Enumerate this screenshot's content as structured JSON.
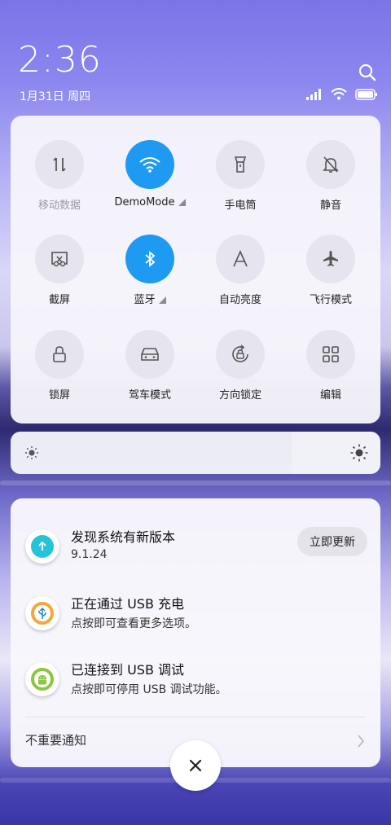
{
  "status": {
    "time": "2:36",
    "date": "1月31日 周四"
  },
  "quick_settings": {
    "row1": [
      {
        "label": "移动数据",
        "icon": "mobile-data-icon",
        "active": false,
        "dim": true
      },
      {
        "label": "DemoMode",
        "icon": "wifi-icon",
        "active": true,
        "has_menu": true
      },
      {
        "label": "手电筒",
        "icon": "flashlight-icon",
        "active": false
      },
      {
        "label": "静音",
        "icon": "bell-off-icon",
        "active": false
      }
    ],
    "row2": [
      {
        "label": "截屏",
        "icon": "screenshot-icon",
        "active": false
      },
      {
        "label": "蓝牙",
        "icon": "bluetooth-icon",
        "active": true,
        "has_menu": true
      },
      {
        "label": "自动亮度",
        "icon": "auto-brightness-icon",
        "active": false
      },
      {
        "label": "飞行模式",
        "icon": "airplane-icon",
        "active": false
      }
    ],
    "row3": [
      {
        "label": "锁屏",
        "icon": "lock-icon",
        "active": false
      },
      {
        "label": "驾车模式",
        "icon": "car-icon",
        "active": false
      },
      {
        "label": "方向锁定",
        "icon": "rotation-lock-icon",
        "active": false
      },
      {
        "label": "编辑",
        "icon": "grid-edit-icon",
        "active": false
      }
    ]
  },
  "brightness": {
    "level": 0.76
  },
  "notifications": [
    {
      "title": "发现系统有新版本",
      "subtitle": "9.1.24",
      "icon": "update-arrow-icon",
      "color": "#26c3d8",
      "action": "立即更新"
    },
    {
      "title": "正在通过 USB 充电",
      "subtitle": "点按即可查看更多选项。",
      "icon": "usb-icon",
      "color": "#f4a73a"
    },
    {
      "title": "已连接到 USB 调试",
      "subtitle": "点按即可停用 USB 调试功能。",
      "icon": "android-icon",
      "color": "#8cc641"
    }
  ],
  "footer": {
    "unimportant_label": "不重要通知"
  },
  "colors": {
    "accent": "#1f9af2"
  }
}
